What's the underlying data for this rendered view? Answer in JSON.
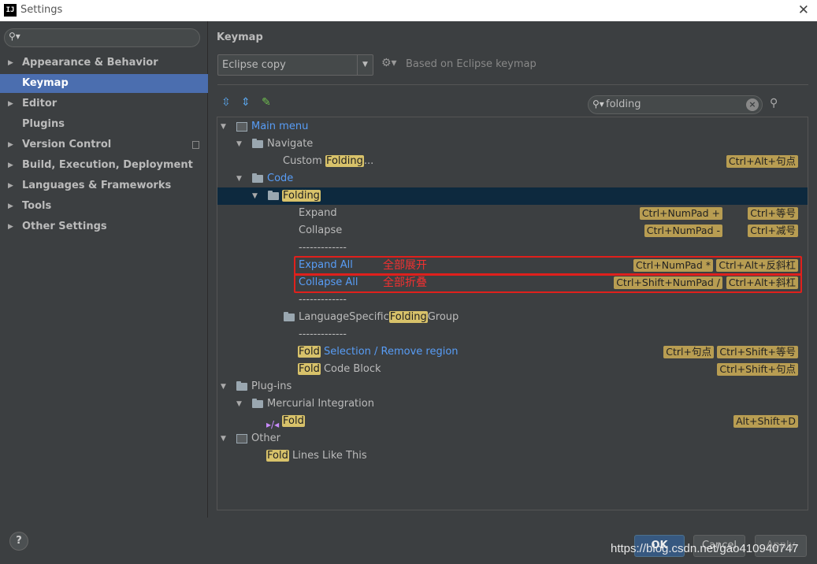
{
  "window": {
    "logo": "IJ",
    "title": "Settings",
    "close": "✕"
  },
  "sidebar": {
    "items": [
      {
        "label": "Appearance & Behavior",
        "arrow": "▶"
      },
      {
        "label": "Keymap",
        "arrow": ""
      },
      {
        "label": "Editor",
        "arrow": "▶"
      },
      {
        "label": "Plugins",
        "arrow": ""
      },
      {
        "label": "Version Control",
        "arrow": "▶"
      },
      {
        "label": "Build, Execution, Deployment",
        "arrow": "▶"
      },
      {
        "label": "Languages & Frameworks",
        "arrow": "▶"
      },
      {
        "label": "Tools",
        "arrow": "▶"
      },
      {
        "label": "Other Settings",
        "arrow": "▶"
      }
    ]
  },
  "main": {
    "heading": "Keymap",
    "keymap_select": "Eclipse copy",
    "based_on": "Based on Eclipse keymap",
    "filter_value": "folding"
  },
  "tree": {
    "main_menu": "Main menu",
    "navigate": "Navigate",
    "custom_prefix": "Custom ",
    "custom_hl": "Folding",
    "custom_suffix": "...",
    "custom_shortcut": "Ctrl+Alt+句点",
    "code": "Code",
    "folding": "Folding",
    "expand": "Expand",
    "expand_sc1": "Ctrl+NumPad +",
    "expand_sc2": "Ctrl+等号",
    "collapse": "Collapse",
    "collapse_sc1": "Ctrl+NumPad -",
    "collapse_sc2": "Ctrl+减号",
    "separator": "-------------",
    "expand_all": "Expand All",
    "expand_all_note": "全部展开",
    "expand_all_sc1": "Ctrl+NumPad *",
    "expand_all_sc2": "Ctrl+Alt+反斜杠",
    "collapse_all": "Collapse All",
    "collapse_all_note": "全部折叠",
    "collapse_all_sc1": "Ctrl+Shift+NumPad /",
    "collapse_all_sc2": "Ctrl+Alt+斜杠",
    "lang_prefix": "LanguageSpecific",
    "lang_hl": "Folding",
    "lang_suffix": "Group",
    "fold_sel_hl": "Fold",
    "fold_sel_rest": " Selection / Remove region",
    "fold_sel_sc1": "Ctrl+句点",
    "fold_sel_sc2": "Ctrl+Shift+等号",
    "fold_block_hl": "Fold",
    "fold_block_rest": " Code Block",
    "fold_block_sc": "Ctrl+Shift+句点",
    "plugins": "Plug-ins",
    "mercurial": "Mercurial Integration",
    "fold": "Fold",
    "fold_sc": "Alt+Shift+D",
    "other": "Other",
    "fold_lines_hl": "Fold",
    "fold_lines_rest": " Lines Like This"
  },
  "buttons": {
    "help": "?",
    "ok": "OK",
    "cancel": "Cancel",
    "apply": "Apply"
  },
  "watermark": "https://blog.csdn.net/gao410940747",
  "icons": [
    "search-icon",
    "gear-icon",
    "expand-all-icon",
    "collapse-all-icon",
    "edit-icon",
    "clear-icon",
    "find-shortcut-icon",
    "folder-icon",
    "menu-icon",
    "plugin-icon",
    "help-icon"
  ],
  "colors": {
    "accent": "#4b6eaf",
    "highlight": "#d8c26a",
    "shortcut": "#b89d52",
    "link": "#589df6",
    "annotation": "#e0201c"
  }
}
